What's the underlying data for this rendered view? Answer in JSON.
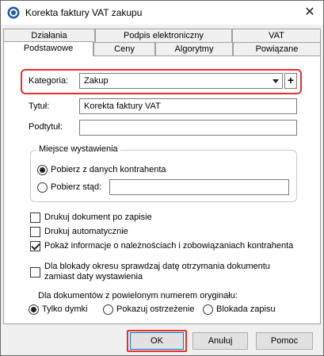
{
  "window": {
    "title": "Korekta faktury VAT zakupu"
  },
  "tabs": {
    "row1": [
      "Działania",
      "Podpis elektroniczny",
      "VAT"
    ],
    "row2": [
      "Podstawowe",
      "Ceny",
      "Algorytmy",
      "Powiązane"
    ],
    "active": "Podstawowe"
  },
  "form": {
    "kategoria_label": "Kategoria:",
    "kategoria_value": "Zakup",
    "plus_label": "+",
    "tytul_label": "Tytuł:",
    "tytul_value": "Korekta faktury VAT",
    "podtytul_label": "Podtytuł:",
    "podtytul_value": ""
  },
  "miejsce": {
    "title": "Miejsce wystawienia",
    "option1": "Pobierz z danych kontrahenta",
    "option2": "Pobierz stąd:",
    "selected": "option1",
    "stad_value": ""
  },
  "checks": [
    {
      "label": "Drukuj dokument po zapisie",
      "checked": false
    },
    {
      "label": "Drukuj automatycznie",
      "checked": false
    },
    {
      "label": "Pokaż informacje o należnościach i zobowiązaniach kontrahenta",
      "checked": true
    }
  ],
  "blokada": {
    "line1": "Dla blokady okresu sprawdzaj datę otrzymania dokumentu",
    "line2": "zamiast daty wystawienia",
    "checked": false
  },
  "powielony": {
    "label": "Dla dokumentów z powielonym numerem oryginału:",
    "options": [
      "Tylko dymki",
      "Pokazuj ostrzeżenie",
      "Blokada zapisu"
    ],
    "selected": "Tylko dymki"
  },
  "buttons": {
    "ok": "OK",
    "cancel": "Anuluj",
    "help": "Pomoc"
  },
  "colors": {
    "highlight": "#e53030",
    "default_button_border": "#0078d7"
  }
}
